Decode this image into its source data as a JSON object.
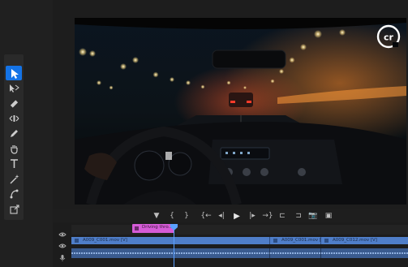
{
  "tools": [
    {
      "name": "selection-tool",
      "icon": "arrow-cursor-icon",
      "active": true
    },
    {
      "name": "track-select-tool",
      "icon": "track-select-icon",
      "active": false
    },
    {
      "name": "ripple-edit-tool",
      "icon": "ripple-edit-icon",
      "active": false
    },
    {
      "name": "slip-tool",
      "icon": "slip-icon",
      "active": false
    },
    {
      "name": "pen-tool",
      "icon": "pen-icon",
      "active": false
    },
    {
      "name": "hand-tool",
      "icon": "hand-icon",
      "active": false
    },
    {
      "name": "type-tool",
      "icon": "type-icon",
      "active": false
    },
    {
      "name": "ai-tool",
      "icon": "magic-wand-icon",
      "active": false
    },
    {
      "name": "shape-tool",
      "icon": "shape-icon",
      "active": false
    },
    {
      "name": "export-tool",
      "icon": "export-icon",
      "active": false
    }
  ],
  "monitor": {
    "logo_text": "cr"
  },
  "transport": [
    {
      "name": "add-marker-button",
      "icon": "marker-icon",
      "glyph": "▼"
    },
    {
      "name": "mark-in-button",
      "icon": "bracket-left-icon",
      "glyph": "{"
    },
    {
      "name": "mark-out-button",
      "icon": "bracket-right-icon",
      "glyph": "}"
    },
    {
      "name": "go-to-in-button",
      "icon": "go-to-in-icon",
      "glyph": "{←"
    },
    {
      "name": "step-back-button",
      "icon": "step-back-icon",
      "glyph": "◂|"
    },
    {
      "name": "play-button",
      "icon": "play-icon",
      "glyph": "▶"
    },
    {
      "name": "step-forward-button",
      "icon": "step-forward-icon",
      "glyph": "|▸"
    },
    {
      "name": "go-to-out-button",
      "icon": "go-to-out-icon",
      "glyph": "→}"
    },
    {
      "name": "insert-button",
      "icon": "insert-icon",
      "glyph": "⊏"
    },
    {
      "name": "overwrite-button",
      "icon": "overwrite-icon",
      "glyph": "⊐"
    },
    {
      "name": "export-frame-button",
      "icon": "camera-icon",
      "glyph": "📷"
    },
    {
      "name": "compare-button",
      "icon": "compare-icon",
      "glyph": "▣"
    }
  ],
  "timeline": {
    "title_clip": "Driving thro.. [V]",
    "video_clips": [
      "A009_C001.mov [V]",
      "A009_C001.mov [V]",
      "A009_C012.mov [V]"
    ]
  },
  "colors": {
    "accent": "#1473e6",
    "title_clip": "#d55bd7",
    "video_clip": "#4f7ec9",
    "audio_clip": "#3a5b8f"
  }
}
